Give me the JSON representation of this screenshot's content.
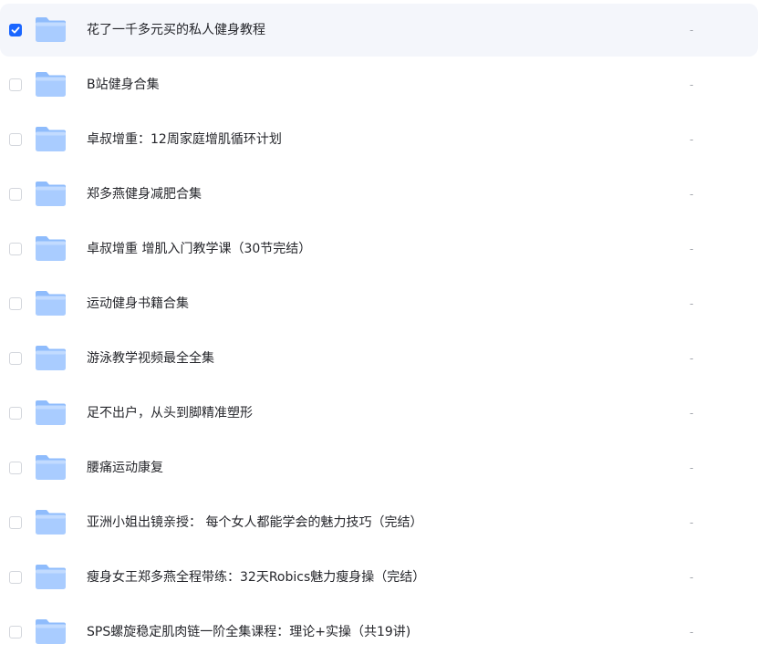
{
  "files": [
    {
      "name": "花了一千多元买的私人健身教程",
      "size": "-",
      "selected": true
    },
    {
      "name": "B站健身合集",
      "size": "-",
      "selected": false
    },
    {
      "name": "卓叔增重：12周家庭增肌循环计划",
      "size": "-",
      "selected": false
    },
    {
      "name": "郑多燕健身减肥合集",
      "size": "-",
      "selected": false
    },
    {
      "name": "卓叔增重 增肌入门教学课（30节完结）",
      "size": "-",
      "selected": false
    },
    {
      "name": "运动健身书籍合集",
      "size": "-",
      "selected": false
    },
    {
      "name": "游泳教学视频最全全集",
      "size": "-",
      "selected": false
    },
    {
      "name": "足不出户，从头到脚精准塑形",
      "size": "-",
      "selected": false
    },
    {
      "name": "腰痛运动康复",
      "size": "-",
      "selected": false
    },
    {
      "name": "亚洲小姐出镜亲授： 每个女人都能学会的魅力技巧（完结）",
      "size": "-",
      "selected": false
    },
    {
      "name": "瘦身女王郑多燕全程带练：32天Robics魅力瘦身操（完结）",
      "size": "-",
      "selected": false
    },
    {
      "name": "SPS螺旋稳定肌肉链一阶全集课程：理论+实操（共19讲)",
      "size": "-",
      "selected": false
    }
  ],
  "colors": {
    "accent": "#1a66ff",
    "selected_row_bg": "#f4f6fb",
    "folder_light": "#bcd7ff",
    "folder_dark": "#7db2fb"
  },
  "icons": {
    "folder": "folder-icon",
    "check": "checkmark-icon"
  }
}
